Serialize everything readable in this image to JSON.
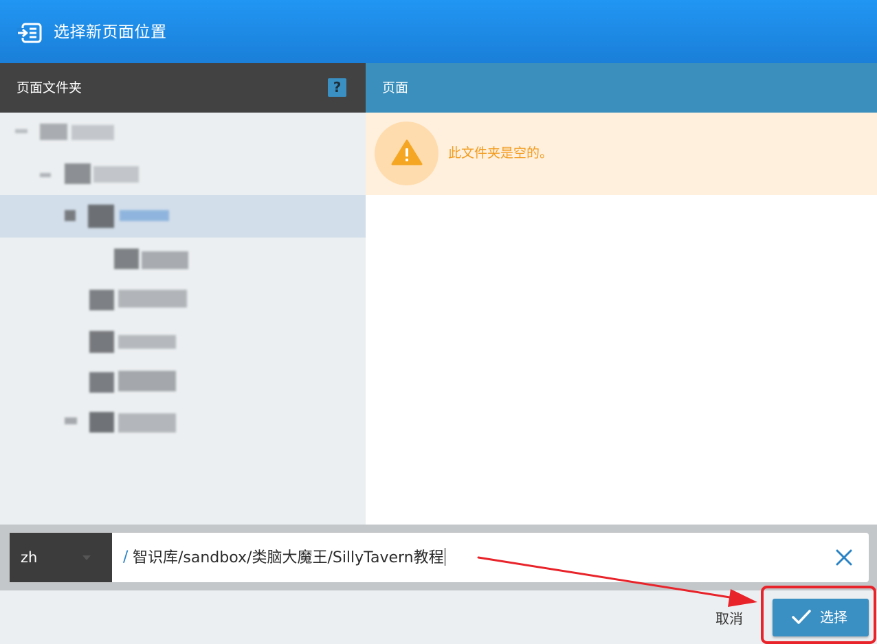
{
  "dialog": {
    "title": "选择新页面位置",
    "title_icon": "page-move-icon"
  },
  "folders_panel": {
    "header": "页面文件夹",
    "help_label": "?",
    "help_icon": "help-icon",
    "tree_note": "folder tree labels are pixelated / unreadable in the screenshot"
  },
  "pages_panel": {
    "header": "页面",
    "empty_message": "此文件夹是空的。",
    "empty_icon": "warning-icon"
  },
  "path_bar": {
    "locale": "zh",
    "locale_icon": "caret-down-icon",
    "slash": "/",
    "path": "智识库/sandbox/类脑大魔王/SillyTavern教程",
    "clear_icon": "close-icon"
  },
  "footer": {
    "cancel_label": "取消",
    "select_label": "选择",
    "select_icon": "check-icon"
  },
  "colors": {
    "header": "#1e88e5",
    "folders_header": "#424242",
    "pages_header": "#3a8fbc",
    "warning_bg": "#fff0de",
    "warning_text": "#f29c1f",
    "annotation_red": "#e8232a",
    "primary_button": "#3a8fc3"
  }
}
